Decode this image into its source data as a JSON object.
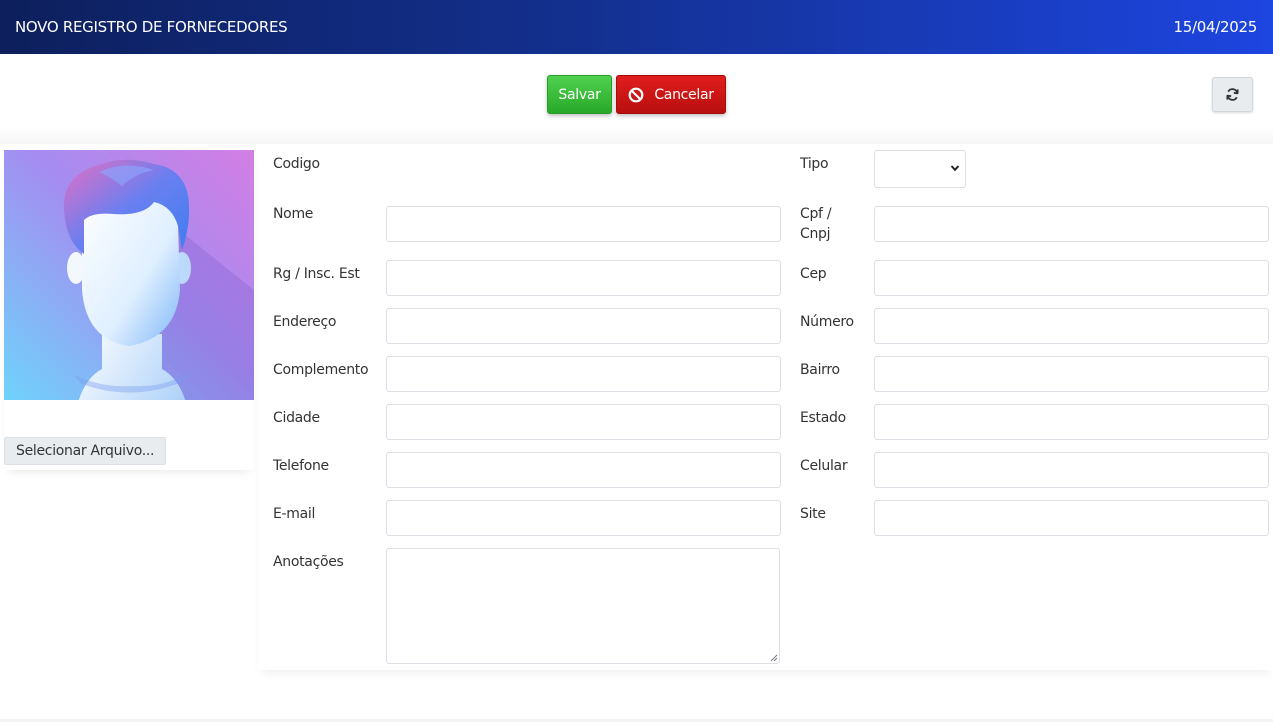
{
  "header": {
    "title": "NOVO REGISTRO DE FORNECEDORES",
    "date": "15/04/2025"
  },
  "toolbar": {
    "save_label": "Salvar",
    "cancel_label": "Cancelar",
    "refresh_icon": "refresh-icon",
    "cancel_icon": "ban-icon"
  },
  "photo": {
    "select_file_label": "Selecionar Arquivo..."
  },
  "form": {
    "left_labels": {
      "codigo": "Codigo",
      "nome": "Nome",
      "rg": "Rg / Insc. Est",
      "endereco": "Endereço",
      "complemento": "Complemento",
      "cidade": "Cidade",
      "telefone": "Telefone",
      "email": "E-mail",
      "anotacoes": "Anotações"
    },
    "right_labels": {
      "tipo": "Tipo",
      "cpf_line1": "Cpf /",
      "cpf_line2": "Cnpj",
      "cep": "Cep",
      "numero": "Número",
      "bairro": "Bairro",
      "estado": "Estado",
      "celular": "Celular",
      "site": "Site"
    },
    "values": {
      "tipo": "",
      "nome": "",
      "cpf_cnpj": "",
      "rg": "",
      "cep": "",
      "endereco": "",
      "numero": "",
      "complemento": "",
      "bairro": "",
      "cidade": "",
      "estado": "",
      "telefone": "",
      "celular": "",
      "email": "",
      "site": "",
      "anotacoes": ""
    }
  },
  "colors": {
    "header_start": "#0d1f5c",
    "header_end": "#1d45e0",
    "save": "#28a828",
    "cancel": "#c41414"
  }
}
